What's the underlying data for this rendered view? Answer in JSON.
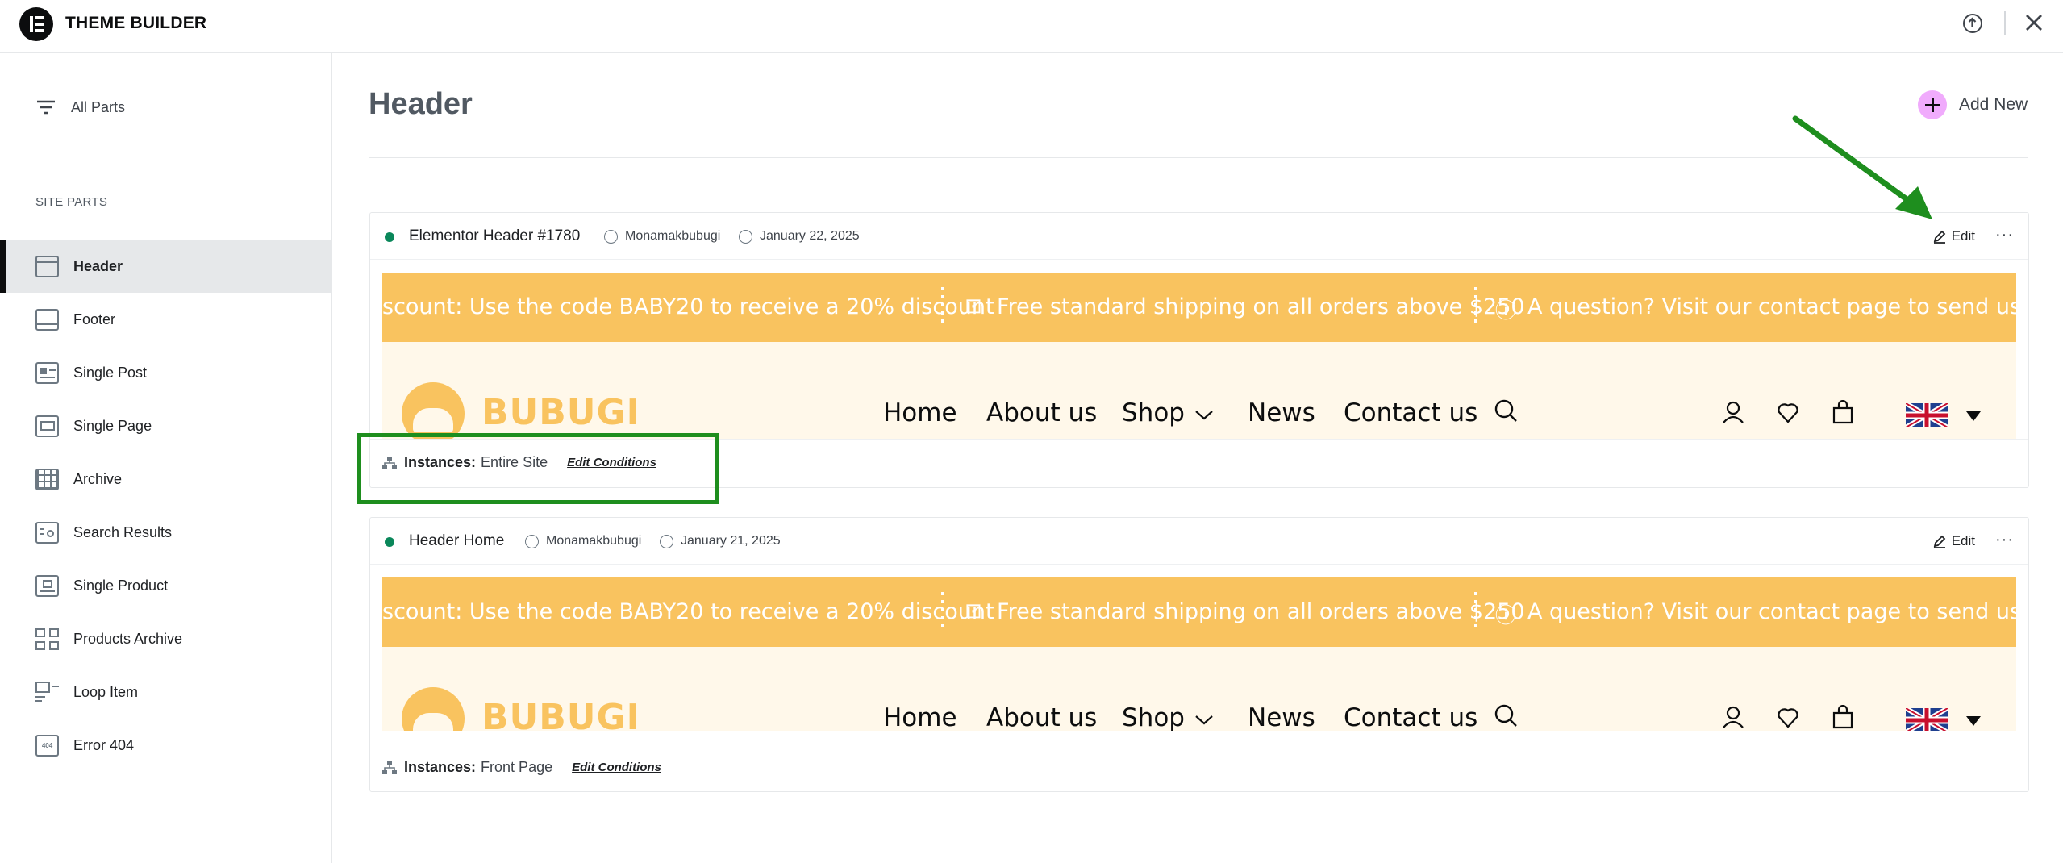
{
  "app": {
    "title": "THEME BUILDER"
  },
  "sidebar": {
    "all_parts": "All Parts",
    "section_title": "SITE PARTS",
    "items": [
      {
        "label": "Header",
        "icon": "header-icon"
      },
      {
        "label": "Footer",
        "icon": "footer-icon"
      },
      {
        "label": "Single Post",
        "icon": "single-post-icon"
      },
      {
        "label": "Single Page",
        "icon": "single-page-icon"
      },
      {
        "label": "Archive",
        "icon": "archive-icon"
      },
      {
        "label": "Search Results",
        "icon": "search-results-icon"
      },
      {
        "label": "Single Product",
        "icon": "single-product-icon"
      },
      {
        "label": "Products Archive",
        "icon": "products-archive-icon"
      },
      {
        "label": "Loop Item",
        "icon": "loop-item-icon"
      },
      {
        "label": "Error 404",
        "icon": "error-404-icon"
      }
    ]
  },
  "main": {
    "title": "Header",
    "add_new": "Add New",
    "cards": [
      {
        "name": "Elementor Header #1780",
        "author": "Monamakbubugi",
        "date": "January 22, 2025",
        "edit": "Edit",
        "more": "···",
        "instances_label": "Instances:",
        "instances_value": "Entire Site",
        "edit_conditions": "Edit Conditions"
      },
      {
        "name": "Header Home",
        "author": "Monamakbubugi",
        "date": "January 21, 2025",
        "edit": "Edit",
        "more": "···",
        "instances_label": "Instances:",
        "instances_value": "Front Page",
        "edit_conditions": "Edit Conditions"
      }
    ],
    "preview": {
      "promo_1": "scount: Use the code BABY20 to receive a 20% discount",
      "promo_2": "Free standard shipping on all orders above $250",
      "promo_3": "A question? Visit our contact page to send us a mes",
      "brand": "BUBUGI",
      "menu": [
        "Home",
        "About us",
        "Shop",
        "News",
        "Contact us"
      ]
    }
  },
  "colors": {
    "accent": "#f0abfc",
    "status": "#0a875a",
    "promo_bg": "#f9c35f",
    "annotation": "#1e8e1e"
  }
}
